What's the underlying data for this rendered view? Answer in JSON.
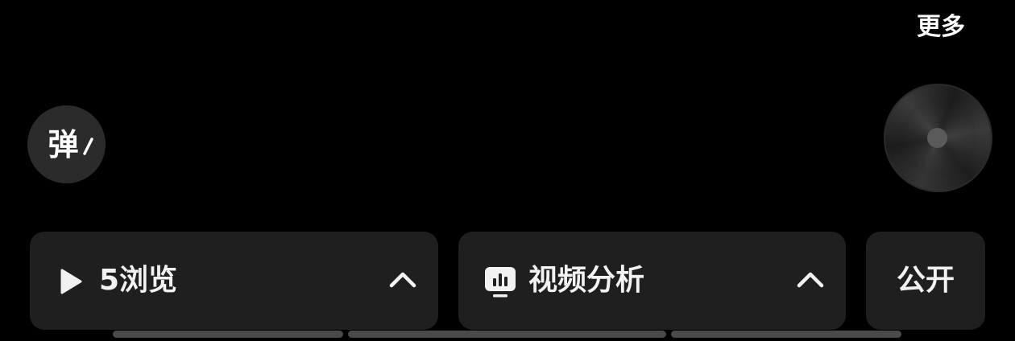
{
  "top_right": {
    "more_label": "更多"
  },
  "danmaku_button": {
    "glyph": "弹",
    "icon": "pen-icon"
  },
  "music_disc": {
    "icon": "disc-icon"
  },
  "cards": {
    "views": {
      "icon": "play-icon",
      "label": "5浏览",
      "chevron": "chevron-up-icon"
    },
    "analysis": {
      "icon": "bar-chart-icon",
      "label": "视频分析",
      "chevron": "chevron-up-icon"
    },
    "visibility": {
      "label": "公开"
    }
  },
  "colors": {
    "background": "#000000",
    "card": "#1f1f1f",
    "text": "#f2f2f2",
    "scroll_indicator": "#4a4a4a"
  }
}
